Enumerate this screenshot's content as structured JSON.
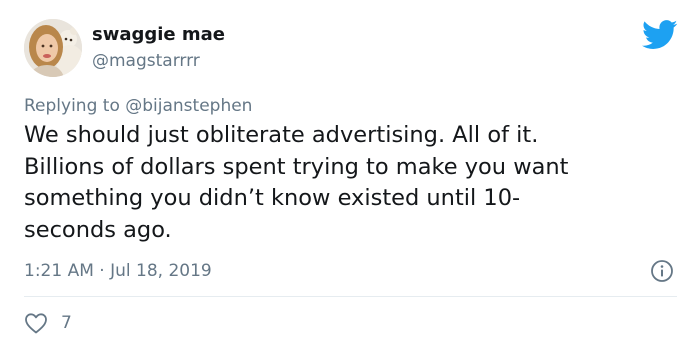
{
  "tweet": {
    "display_name": "swaggie mae",
    "handle": "@magstarrrr",
    "replying_prefix": "Replying to ",
    "replying_to": "@bijanstephen",
    "text_lines": [
      "We should just obliterate advertising. All of it.",
      "Billions of dollars spent trying to make you want",
      "something you didn’t know existed until 10-",
      "seconds ago."
    ],
    "timestamp": "1:21 AM · Jul 18, 2019",
    "like_count": "7"
  },
  "icons": {
    "brand": "twitter-bird-icon",
    "info": "info-icon",
    "like": "heart-icon"
  },
  "colors": {
    "brand": "#1da1f2",
    "text": "#14171a",
    "secondary": "#657786",
    "divider": "#e6ecf0"
  }
}
